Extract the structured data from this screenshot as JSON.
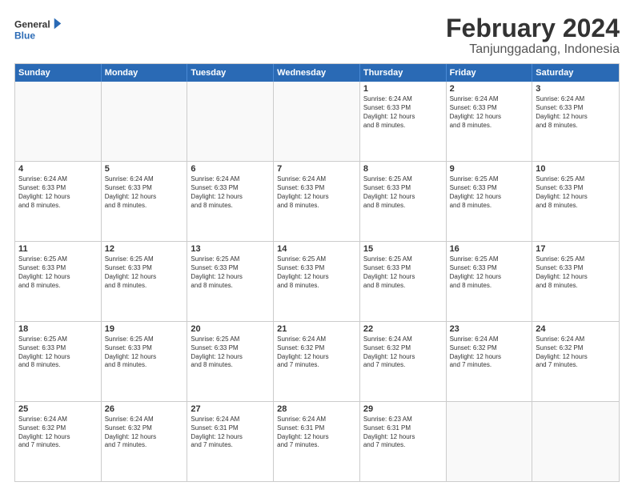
{
  "logo": {
    "line1": "General",
    "line2": "Blue"
  },
  "title": "February 2024",
  "subtitle": "Tanjunggadang, Indonesia",
  "days": [
    "Sunday",
    "Monday",
    "Tuesday",
    "Wednesday",
    "Thursday",
    "Friday",
    "Saturday"
  ],
  "weeks": [
    [
      {
        "day": "",
        "info": ""
      },
      {
        "day": "",
        "info": ""
      },
      {
        "day": "",
        "info": ""
      },
      {
        "day": "",
        "info": ""
      },
      {
        "day": "1",
        "info": "Sunrise: 6:24 AM\nSunset: 6:33 PM\nDaylight: 12 hours\nand 8 minutes."
      },
      {
        "day": "2",
        "info": "Sunrise: 6:24 AM\nSunset: 6:33 PM\nDaylight: 12 hours\nand 8 minutes."
      },
      {
        "day": "3",
        "info": "Sunrise: 6:24 AM\nSunset: 6:33 PM\nDaylight: 12 hours\nand 8 minutes."
      }
    ],
    [
      {
        "day": "4",
        "info": "Sunrise: 6:24 AM\nSunset: 6:33 PM\nDaylight: 12 hours\nand 8 minutes."
      },
      {
        "day": "5",
        "info": "Sunrise: 6:24 AM\nSunset: 6:33 PM\nDaylight: 12 hours\nand 8 minutes."
      },
      {
        "day": "6",
        "info": "Sunrise: 6:24 AM\nSunset: 6:33 PM\nDaylight: 12 hours\nand 8 minutes."
      },
      {
        "day": "7",
        "info": "Sunrise: 6:24 AM\nSunset: 6:33 PM\nDaylight: 12 hours\nand 8 minutes."
      },
      {
        "day": "8",
        "info": "Sunrise: 6:25 AM\nSunset: 6:33 PM\nDaylight: 12 hours\nand 8 minutes."
      },
      {
        "day": "9",
        "info": "Sunrise: 6:25 AM\nSunset: 6:33 PM\nDaylight: 12 hours\nand 8 minutes."
      },
      {
        "day": "10",
        "info": "Sunrise: 6:25 AM\nSunset: 6:33 PM\nDaylight: 12 hours\nand 8 minutes."
      }
    ],
    [
      {
        "day": "11",
        "info": "Sunrise: 6:25 AM\nSunset: 6:33 PM\nDaylight: 12 hours\nand 8 minutes."
      },
      {
        "day": "12",
        "info": "Sunrise: 6:25 AM\nSunset: 6:33 PM\nDaylight: 12 hours\nand 8 minutes."
      },
      {
        "day": "13",
        "info": "Sunrise: 6:25 AM\nSunset: 6:33 PM\nDaylight: 12 hours\nand 8 minutes."
      },
      {
        "day": "14",
        "info": "Sunrise: 6:25 AM\nSunset: 6:33 PM\nDaylight: 12 hours\nand 8 minutes."
      },
      {
        "day": "15",
        "info": "Sunrise: 6:25 AM\nSunset: 6:33 PM\nDaylight: 12 hours\nand 8 minutes."
      },
      {
        "day": "16",
        "info": "Sunrise: 6:25 AM\nSunset: 6:33 PM\nDaylight: 12 hours\nand 8 minutes."
      },
      {
        "day": "17",
        "info": "Sunrise: 6:25 AM\nSunset: 6:33 PM\nDaylight: 12 hours\nand 8 minutes."
      }
    ],
    [
      {
        "day": "18",
        "info": "Sunrise: 6:25 AM\nSunset: 6:33 PM\nDaylight: 12 hours\nand 8 minutes."
      },
      {
        "day": "19",
        "info": "Sunrise: 6:25 AM\nSunset: 6:33 PM\nDaylight: 12 hours\nand 8 minutes."
      },
      {
        "day": "20",
        "info": "Sunrise: 6:25 AM\nSunset: 6:33 PM\nDaylight: 12 hours\nand 8 minutes."
      },
      {
        "day": "21",
        "info": "Sunrise: 6:24 AM\nSunset: 6:32 PM\nDaylight: 12 hours\nand 7 minutes."
      },
      {
        "day": "22",
        "info": "Sunrise: 6:24 AM\nSunset: 6:32 PM\nDaylight: 12 hours\nand 7 minutes."
      },
      {
        "day": "23",
        "info": "Sunrise: 6:24 AM\nSunset: 6:32 PM\nDaylight: 12 hours\nand 7 minutes."
      },
      {
        "day": "24",
        "info": "Sunrise: 6:24 AM\nSunset: 6:32 PM\nDaylight: 12 hours\nand 7 minutes."
      }
    ],
    [
      {
        "day": "25",
        "info": "Sunrise: 6:24 AM\nSunset: 6:32 PM\nDaylight: 12 hours\nand 7 minutes."
      },
      {
        "day": "26",
        "info": "Sunrise: 6:24 AM\nSunset: 6:32 PM\nDaylight: 12 hours\nand 7 minutes."
      },
      {
        "day": "27",
        "info": "Sunrise: 6:24 AM\nSunset: 6:31 PM\nDaylight: 12 hours\nand 7 minutes."
      },
      {
        "day": "28",
        "info": "Sunrise: 6:24 AM\nSunset: 6:31 PM\nDaylight: 12 hours\nand 7 minutes."
      },
      {
        "day": "29",
        "info": "Sunrise: 6:23 AM\nSunset: 6:31 PM\nDaylight: 12 hours\nand 7 minutes."
      },
      {
        "day": "",
        "info": ""
      },
      {
        "day": "",
        "info": ""
      }
    ]
  ]
}
